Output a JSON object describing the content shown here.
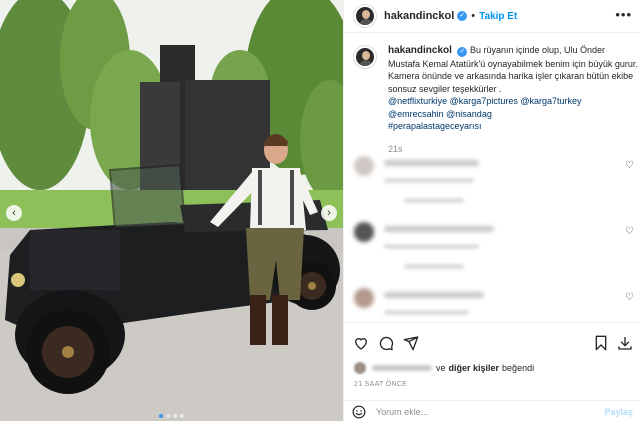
{
  "post": {
    "username": "hakandinckol",
    "follow_label": "Takip Et",
    "separator": "•",
    "more_label": "•••"
  },
  "caption": {
    "username": "hakandinckol",
    "text_1": "Bu rüyanın içinde olup, Ulu Önder Mustafa Kemal Atatürk'ü oynayabilmek benim için büyük gurur. Kamera önünde ve arkasında harika işler çıkaran bütün ekibe sonsuz sevgiler teşekkürler .",
    "mentions": "@netflixturkiye @karga7pictures @karga7turkey @emrecsahin @nisandag",
    "hashtag": "#perapalastageceyarısı",
    "time": "21s"
  },
  "likes": {
    "connector": "ve",
    "others": "diğer kişiler",
    "suffix": "beğendi"
  },
  "post_time": "21 SAAT ÖNCE",
  "comment_box": {
    "placeholder": "Yorum ekle...",
    "post_label": "Paylaş"
  },
  "carousel": {
    "prev_label": "‹",
    "next_label": "›",
    "dot_count": 4,
    "active_dot": 1
  },
  "colors": {
    "accent": "#0095f6",
    "verified": "#3897f0",
    "text": "#262626",
    "muted": "#8e8e8e"
  },
  "icons": [
    "heart-icon",
    "comment-icon",
    "share-icon",
    "bookmark-icon",
    "download-icon",
    "emoji-icon",
    "verified-icon",
    "more-icon"
  ]
}
